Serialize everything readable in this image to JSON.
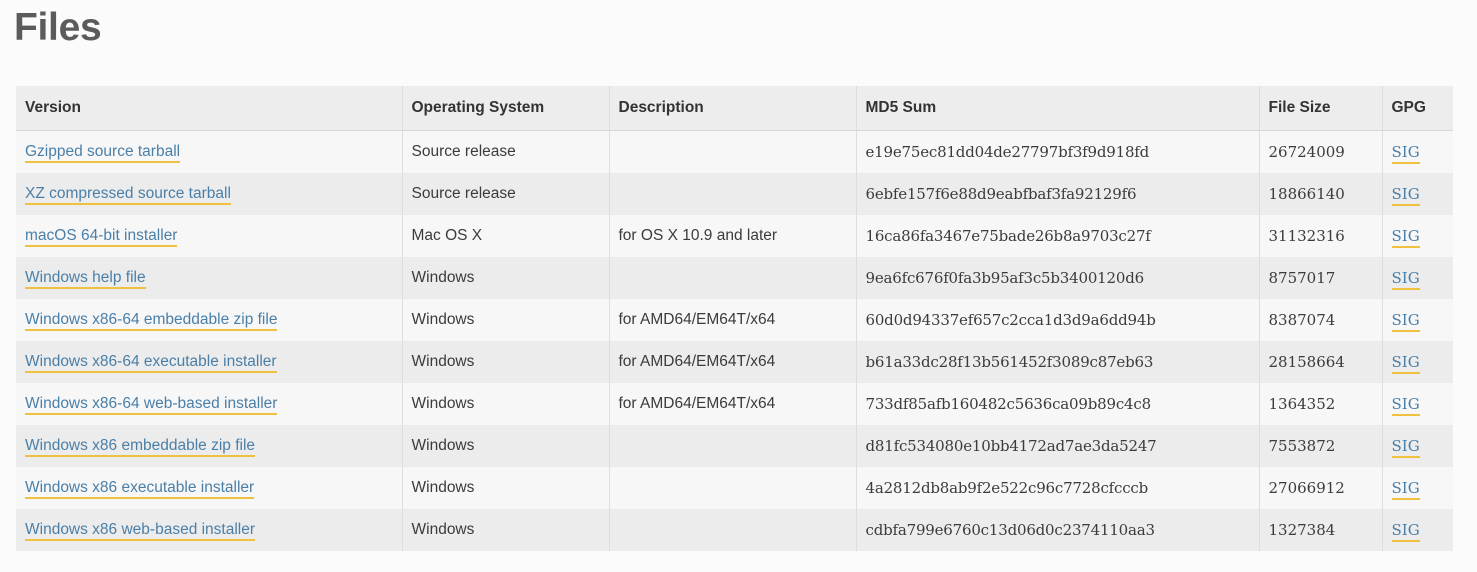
{
  "page": {
    "title": "Files"
  },
  "table": {
    "columns": [
      {
        "key": "version",
        "label": "Version"
      },
      {
        "key": "os",
        "label": "Operating System"
      },
      {
        "key": "description",
        "label": "Description"
      },
      {
        "key": "md5",
        "label": "MD5 Sum"
      },
      {
        "key": "size",
        "label": "File Size"
      },
      {
        "key": "gpg",
        "label": "GPG"
      }
    ],
    "gpg_link_label": "SIG",
    "rows": [
      {
        "version": "Gzipped source tarball",
        "os": "Source release",
        "description": "",
        "md5": "e19e75ec81dd04de27797bf3f9d918fd",
        "size": "26724009",
        "gpg": "SIG"
      },
      {
        "version": "XZ compressed source tarball",
        "os": "Source release",
        "description": "",
        "md5": "6ebfe157f6e88d9eabfbaf3fa92129f6",
        "size": "18866140",
        "gpg": "SIG"
      },
      {
        "version": "macOS 64-bit installer",
        "os": "Mac OS X",
        "description": "for OS X 10.9 and later",
        "md5": "16ca86fa3467e75bade26b8a9703c27f",
        "size": "31132316",
        "gpg": "SIG"
      },
      {
        "version": "Windows help file",
        "os": "Windows",
        "description": "",
        "md5": "9ea6fc676f0fa3b95af3c5b3400120d6",
        "size": "8757017",
        "gpg": "SIG"
      },
      {
        "version": "Windows x86-64 embeddable zip file",
        "os": "Windows",
        "description": "for AMD64/EM64T/x64",
        "md5": "60d0d94337ef657c2cca1d3d9a6dd94b",
        "size": "8387074",
        "gpg": "SIG"
      },
      {
        "version": "Windows x86-64 executable installer",
        "os": "Windows",
        "description": "for AMD64/EM64T/x64",
        "md5": "b61a33dc28f13b561452f3089c87eb63",
        "size": "28158664",
        "gpg": "SIG"
      },
      {
        "version": "Windows x86-64 web-based installer",
        "os": "Windows",
        "description": "for AMD64/EM64T/x64",
        "md5": "733df85afb160482c5636ca09b89c4c8",
        "size": "1364352",
        "gpg": "SIG"
      },
      {
        "version": "Windows x86 embeddable zip file",
        "os": "Windows",
        "description": "",
        "md5": "d81fc534080e10bb4172ad7ae3da5247",
        "size": "7553872",
        "gpg": "SIG"
      },
      {
        "version": "Windows x86 executable installer",
        "os": "Windows",
        "description": "",
        "md5": "4a2812db8ab9f2e522c96c7728cfcccb",
        "size": "27066912",
        "gpg": "SIG"
      },
      {
        "version": "Windows x86 web-based installer",
        "os": "Windows",
        "description": "",
        "md5": "cdbfa799e6760c13d06d0c2374110aa3",
        "size": "1327384",
        "gpg": "SIG"
      }
    ]
  },
  "colors": {
    "page_background": "#fbfbfb",
    "heading": "#5b5b5b",
    "header_row_background": "#ededed",
    "row_odd_background": "#f7f7f7",
    "row_even_background": "#ececec",
    "cell_border": "#dddddd",
    "link": "#4a7fa8",
    "link_underline": "#f0c040",
    "text": "#3b3b3b"
  }
}
